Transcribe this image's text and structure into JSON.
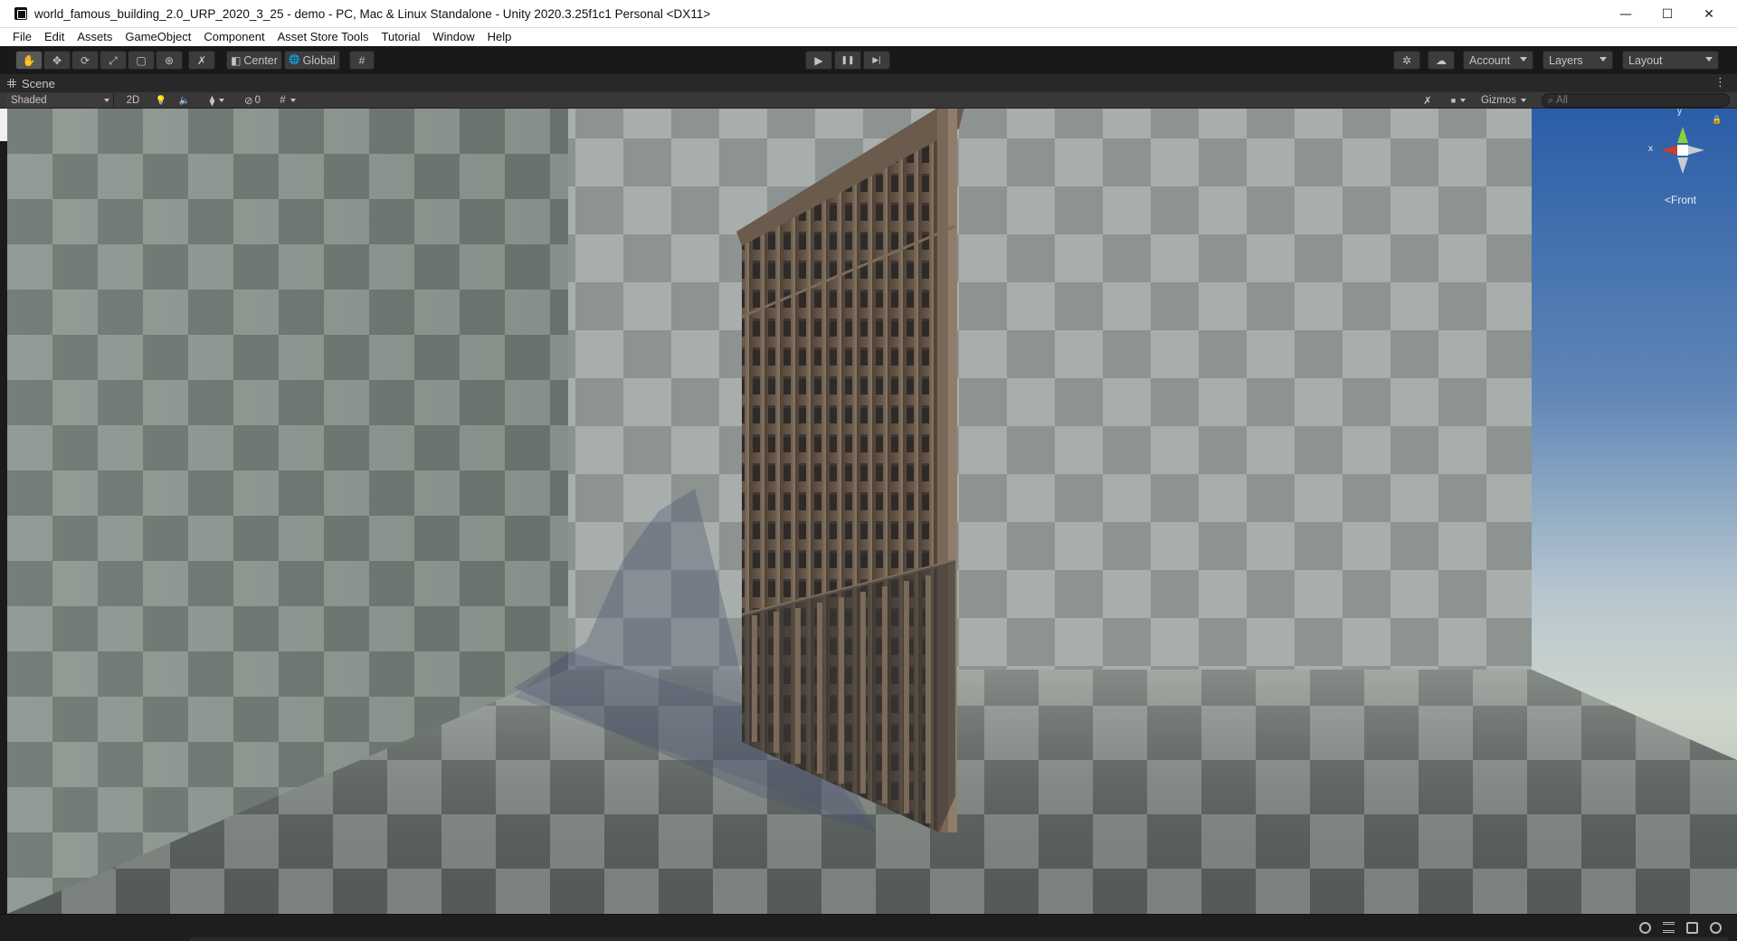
{
  "window": {
    "title": "world_famous_building_2.0_URP_2020_3_25 - demo - PC, Mac & Linux Standalone - Unity 2020.3.25f1c1 Personal <DX11>",
    "minimize_glyph": "—",
    "maximize_glyph": "☐",
    "close_glyph": "✕"
  },
  "menubar": {
    "items": [
      {
        "label": "File"
      },
      {
        "label": "Edit"
      },
      {
        "label": "Assets"
      },
      {
        "label": "GameObject"
      },
      {
        "label": "Component"
      },
      {
        "label": "Asset Store Tools"
      },
      {
        "label": "Tutorial"
      },
      {
        "label": "Window"
      },
      {
        "label": "Help"
      }
    ]
  },
  "toolbar": {
    "tools": [
      {
        "name": "hand-tool",
        "icon": "hand-icon",
        "glyph": "✋"
      },
      {
        "name": "move-tool",
        "icon": "move-icon",
        "glyph": "✥"
      },
      {
        "name": "rotate-tool",
        "icon": "rotate-icon",
        "glyph": "⟳"
      },
      {
        "name": "scale-tool",
        "icon": "scale-icon",
        "glyph": "⤢"
      },
      {
        "name": "rect-tool",
        "icon": "rect-icon",
        "glyph": "▢"
      },
      {
        "name": "transform-tool",
        "icon": "transform-icon",
        "glyph": "⊛"
      },
      {
        "name": "custom-tool",
        "icon": "wrench-icon",
        "glyph": "✗"
      }
    ],
    "pivot_label": "Center",
    "pivot_glyph": "◧",
    "space_label": "Global",
    "space_glyph": "🌐",
    "snap_glyph": "#",
    "play_glyph": "▶",
    "pause_glyph": "❚❚",
    "step_glyph": "▶|",
    "collab_glyph": "✲",
    "cloud_glyph": "☁",
    "account_label": "Account",
    "layers_label": "Layers",
    "layout_label": "Layout"
  },
  "scene_tab": {
    "label": "Scene",
    "menu_glyph": "⋮"
  },
  "scene_toolbar": {
    "draw_mode": "Shaded",
    "mode_2d": "2D",
    "lighting_glyph": "💡",
    "audio_glyph": "🔈",
    "effects_glyph": "⧫",
    "hidden_count": "0",
    "hidden_glyph": "⊘",
    "grid_glyph": "#",
    "tools_glyph": "✗",
    "camera_glyph": "■",
    "gizmos_label": "Gizmos",
    "search_placeholder": "All",
    "search_glyph": "⌕"
  },
  "scene_gizmo": {
    "y_label": "y",
    "x_label": "x",
    "view_label": "<Front",
    "lock_glyph": "🔒"
  },
  "statusbar": {
    "icons": [
      "bug-icon",
      "layers-icon",
      "progress-icon",
      "check-icon"
    ]
  },
  "colors": {
    "editor_bg": "#191919",
    "button_bg": "#3c3c3c",
    "sky_top": "#2b5ea8",
    "sky_horizon": "#c9d3c9",
    "building_stone": "#5a4d42"
  }
}
